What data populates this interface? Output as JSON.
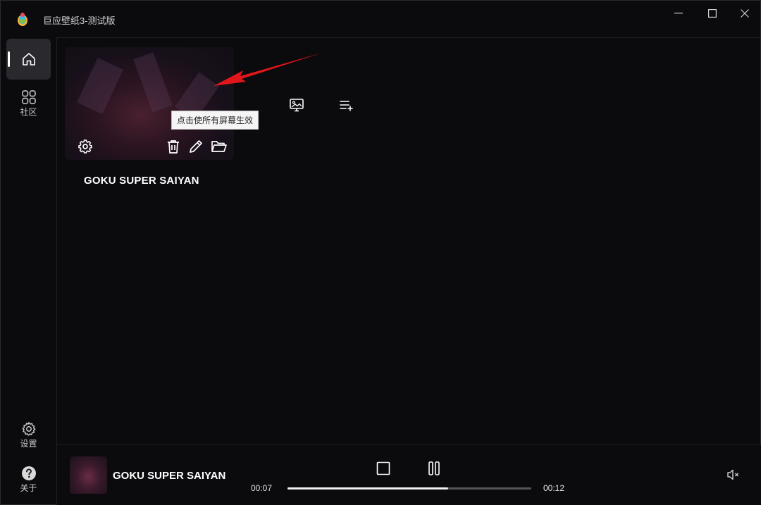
{
  "app": {
    "title": "巨应壁纸3-测试版"
  },
  "sidebar": {
    "community_label": "社区",
    "settings_label": "设置",
    "about_label": "关于"
  },
  "wallpaper": {
    "title": "GOKU SUPER SAIYAN",
    "tooltip": "点击使所有屏幕生效"
  },
  "player": {
    "title": "GOKU SUPER SAIYAN",
    "current_time": "00:07",
    "total_time": "00:12",
    "progress_fraction": 0.66
  },
  "colors": {
    "background": "#0b0a0d",
    "active_nav": "#2a292e",
    "annotation_arrow": "#e0161b"
  }
}
